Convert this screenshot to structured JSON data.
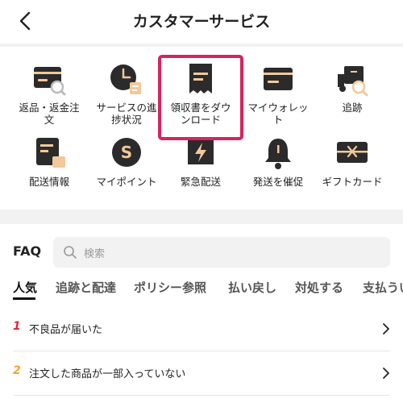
{
  "header": {
    "title": "カスタマーサービス",
    "back_icon": "chevron-left-icon"
  },
  "services": [
    {
      "label_1": "返品・返金注",
      "label_2": "文",
      "icon": "return-refund-icon"
    },
    {
      "label_1": "サービスの進",
      "label_2": "捗状況",
      "icon": "progress-clock-icon"
    },
    {
      "label_1": "領収書をダウ",
      "label_2": "ンロード",
      "icon": "receipt-download-icon"
    },
    {
      "label_1": "マイウォレッ",
      "label_2": "ト",
      "icon": "wallet-icon"
    },
    {
      "label_1": "追跡",
      "label_2": "",
      "icon": "tracking-truck-icon"
    },
    {
      "label_1": "配送情報",
      "label_2": "",
      "icon": "shipping-info-icon"
    },
    {
      "label_1": "マイポイント",
      "label_2": "",
      "icon": "points-icon"
    },
    {
      "label_1": "緊急配送",
      "label_2": "",
      "icon": "urgent-delivery-icon"
    },
    {
      "label_1": "発送を催促",
      "label_2": "",
      "icon": "bell-icon"
    },
    {
      "label_1": "ギフトカード",
      "label_2": "",
      "icon": "gift-card-icon"
    }
  ],
  "faq": {
    "title": "FAQ",
    "search_placeholder": "検索",
    "tabs": [
      "人気",
      "追跡と配達",
      "ポリシー参照",
      "払い戻し",
      "対処する",
      "支払うい"
    ],
    "items": [
      {
        "num": "1",
        "text": "不良品が届いた",
        "num_color": "#e0243a"
      },
      {
        "num": "2",
        "text": "注文した商品が一部入っていない",
        "num_color": "#f0a830"
      }
    ]
  },
  "colors": {
    "icon_dark": "#2b2b2b",
    "icon_accent": "#f2c99a",
    "highlight": "#d6245c"
  }
}
